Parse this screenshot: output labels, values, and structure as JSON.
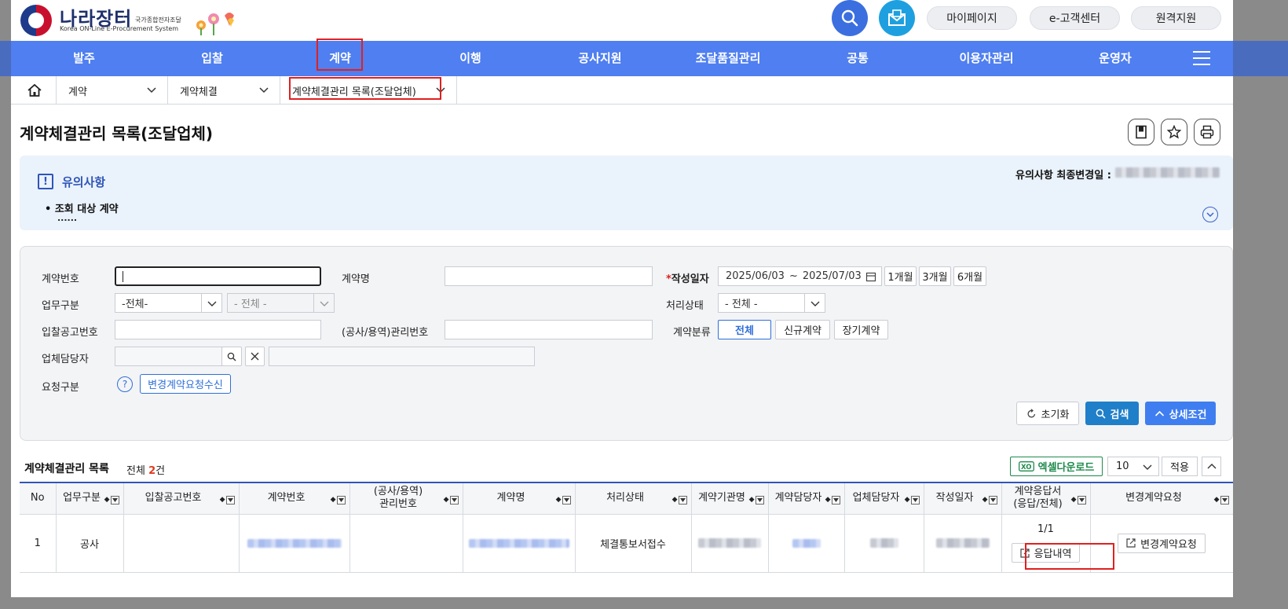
{
  "header": {
    "logo_text": "나라장터",
    "logo_sub": "국가종합전자조달",
    "logo_eng": "Korea ON-Line E-Procurement System",
    "pills": [
      "마이페이지",
      "e-고객센터",
      "원격지원"
    ]
  },
  "nav": {
    "items": [
      "발주",
      "입찰",
      "계약",
      "이행",
      "공사지원",
      "조달품질관리",
      "공통",
      "이용자관리",
      "운영자"
    ],
    "active": "계약"
  },
  "breadcrumb": {
    "level1": "계약",
    "level2": "계약체결",
    "level3": "계약체결관리 목록(조달업체)"
  },
  "page": {
    "title": "계약체결관리 목록(조달업체)"
  },
  "notice": {
    "title": "유의사항",
    "item": "• 조회 대상 계약",
    "dots": "......",
    "date_label": "유의사항 최종변경일 :"
  },
  "form": {
    "contract_no_label": "계약번호",
    "contract_name_label": "계약명",
    "date_label": "작성일자",
    "date_required_mark": "*",
    "date_from": "2025/06/03",
    "date_tilde": "~",
    "date_to": "2025/07/03",
    "period_buttons": [
      "1개월",
      "3개월",
      "6개월"
    ],
    "biz_type_label": "업무구분",
    "biz_type_value": "-전체-",
    "biz_sub_value": "- 전체 -",
    "status_label": "처리상태",
    "status_value": "- 전체 -",
    "bid_no_label": "입찰공고번호",
    "mgmt_no_label": "(공사/용역)관리번호",
    "class_label": "계약분류",
    "class_buttons": [
      "전체",
      "신규계약",
      "장기계약"
    ],
    "manager_label": "업체담당자",
    "request_label": "요청구분",
    "request_button": "변경계약요청수신",
    "reset_button": "초기화",
    "search_button": "검색",
    "detail_button": "상세조건"
  },
  "list": {
    "title": "계약체결관리 목록",
    "total_prefix": "전체 ",
    "total_count": "2",
    "total_suffix": "건",
    "excel_button": "엑셀다운로드",
    "page_size": "10",
    "apply_button": "적용",
    "columns": [
      "No",
      "업무구분",
      "입찰공고번호",
      "계약번호",
      "(공사/용역)\n관리번호",
      "계약명",
      "처리상태",
      "계약기관명",
      "계약담당자",
      "업체담당자",
      "작성일자",
      "계약응답서\n(응답/전체)",
      "변경계약요청"
    ],
    "rows": [
      {
        "no": "1",
        "biz_type": "공사",
        "status": "체결통보서접수",
        "response_ratio": "1/1",
        "response_button": "응답내역",
        "change_button": "변경계약요청"
      }
    ]
  },
  "colors": {
    "nav_bg": "#4f7ff0",
    "accent_blue": "#2f6fd9",
    "highlight_red": "#e02020",
    "excel_green": "#1e8a4c"
  }
}
